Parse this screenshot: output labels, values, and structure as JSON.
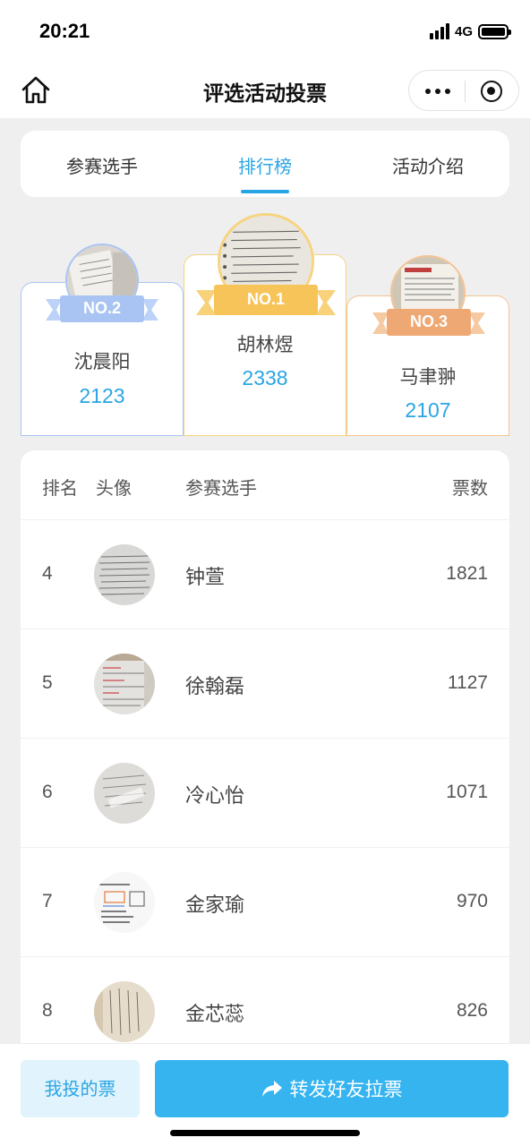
{
  "status_bar": {
    "time": "20:21",
    "network": "4G"
  },
  "nav": {
    "title": "评选活动投票"
  },
  "tabs": [
    {
      "label": "参赛选手",
      "active": false
    },
    {
      "label": "排行榜",
      "active": true
    },
    {
      "label": "活动介绍",
      "active": false
    }
  ],
  "podium": {
    "first": {
      "badge": "NO.1",
      "name": "胡林煜",
      "votes": "2338"
    },
    "second": {
      "badge": "NO.2",
      "name": "沈晨阳",
      "votes": "2123"
    },
    "third": {
      "badge": "NO.3",
      "name": "马聿翀",
      "votes": "2107"
    }
  },
  "ranking": {
    "headers": {
      "rank": "排名",
      "avatar": "头像",
      "name": "参赛选手",
      "votes": "票数"
    },
    "rows": [
      {
        "rank": "4",
        "name": "钟萱",
        "votes": "1821"
      },
      {
        "rank": "5",
        "name": "徐翰磊",
        "votes": "1127"
      },
      {
        "rank": "6",
        "name": "冷心怡",
        "votes": "1071"
      },
      {
        "rank": "7",
        "name": "金家瑜",
        "votes": "970"
      },
      {
        "rank": "8",
        "name": "金芯蕊",
        "votes": "826"
      }
    ]
  },
  "bottom": {
    "my_votes_label": "我投的票",
    "share_label": "转发好友拉票"
  },
  "colors": {
    "accent": "#2aa5e4",
    "gold": "#f6c458",
    "silver_blue": "#a9c4f3",
    "bronze": "#eea873"
  }
}
